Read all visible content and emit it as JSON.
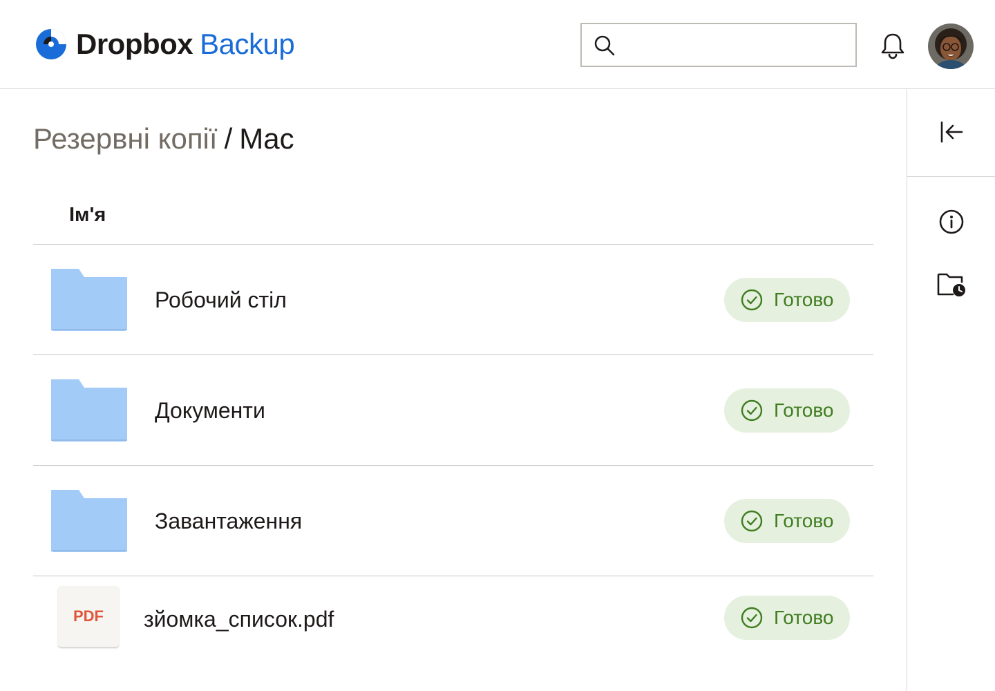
{
  "brand": {
    "name": "Dropbox",
    "product": "Backup",
    "accent": "#1a6cd8"
  },
  "search": {
    "value": "",
    "placeholder": ""
  },
  "breadcrumb": {
    "parent": "Резервні копії",
    "separator": "/",
    "current": "Mac"
  },
  "table": {
    "column_name": "Ім'я"
  },
  "items": [
    {
      "name": "Робочий стіл",
      "type": "folder",
      "status": "Готово"
    },
    {
      "name": "Документи",
      "type": "folder",
      "status": "Готово"
    },
    {
      "name": "Завантаження",
      "type": "folder",
      "status": "Готово"
    },
    {
      "name": "зйомка_список.pdf",
      "type": "pdf",
      "badge": "PDF",
      "status": "Готово"
    }
  ],
  "icons": {
    "search": "search-icon",
    "bell": "bell-icon",
    "collapse": "collapse-panel-icon",
    "info": "info-icon",
    "folder_clock": "folder-clock-icon",
    "status": "check-circle-icon"
  },
  "colors": {
    "status_bg": "#e6f0df",
    "status_text": "#3f7d20",
    "folder": "#a3cbf7",
    "pdf_badge": "#e0563a"
  }
}
